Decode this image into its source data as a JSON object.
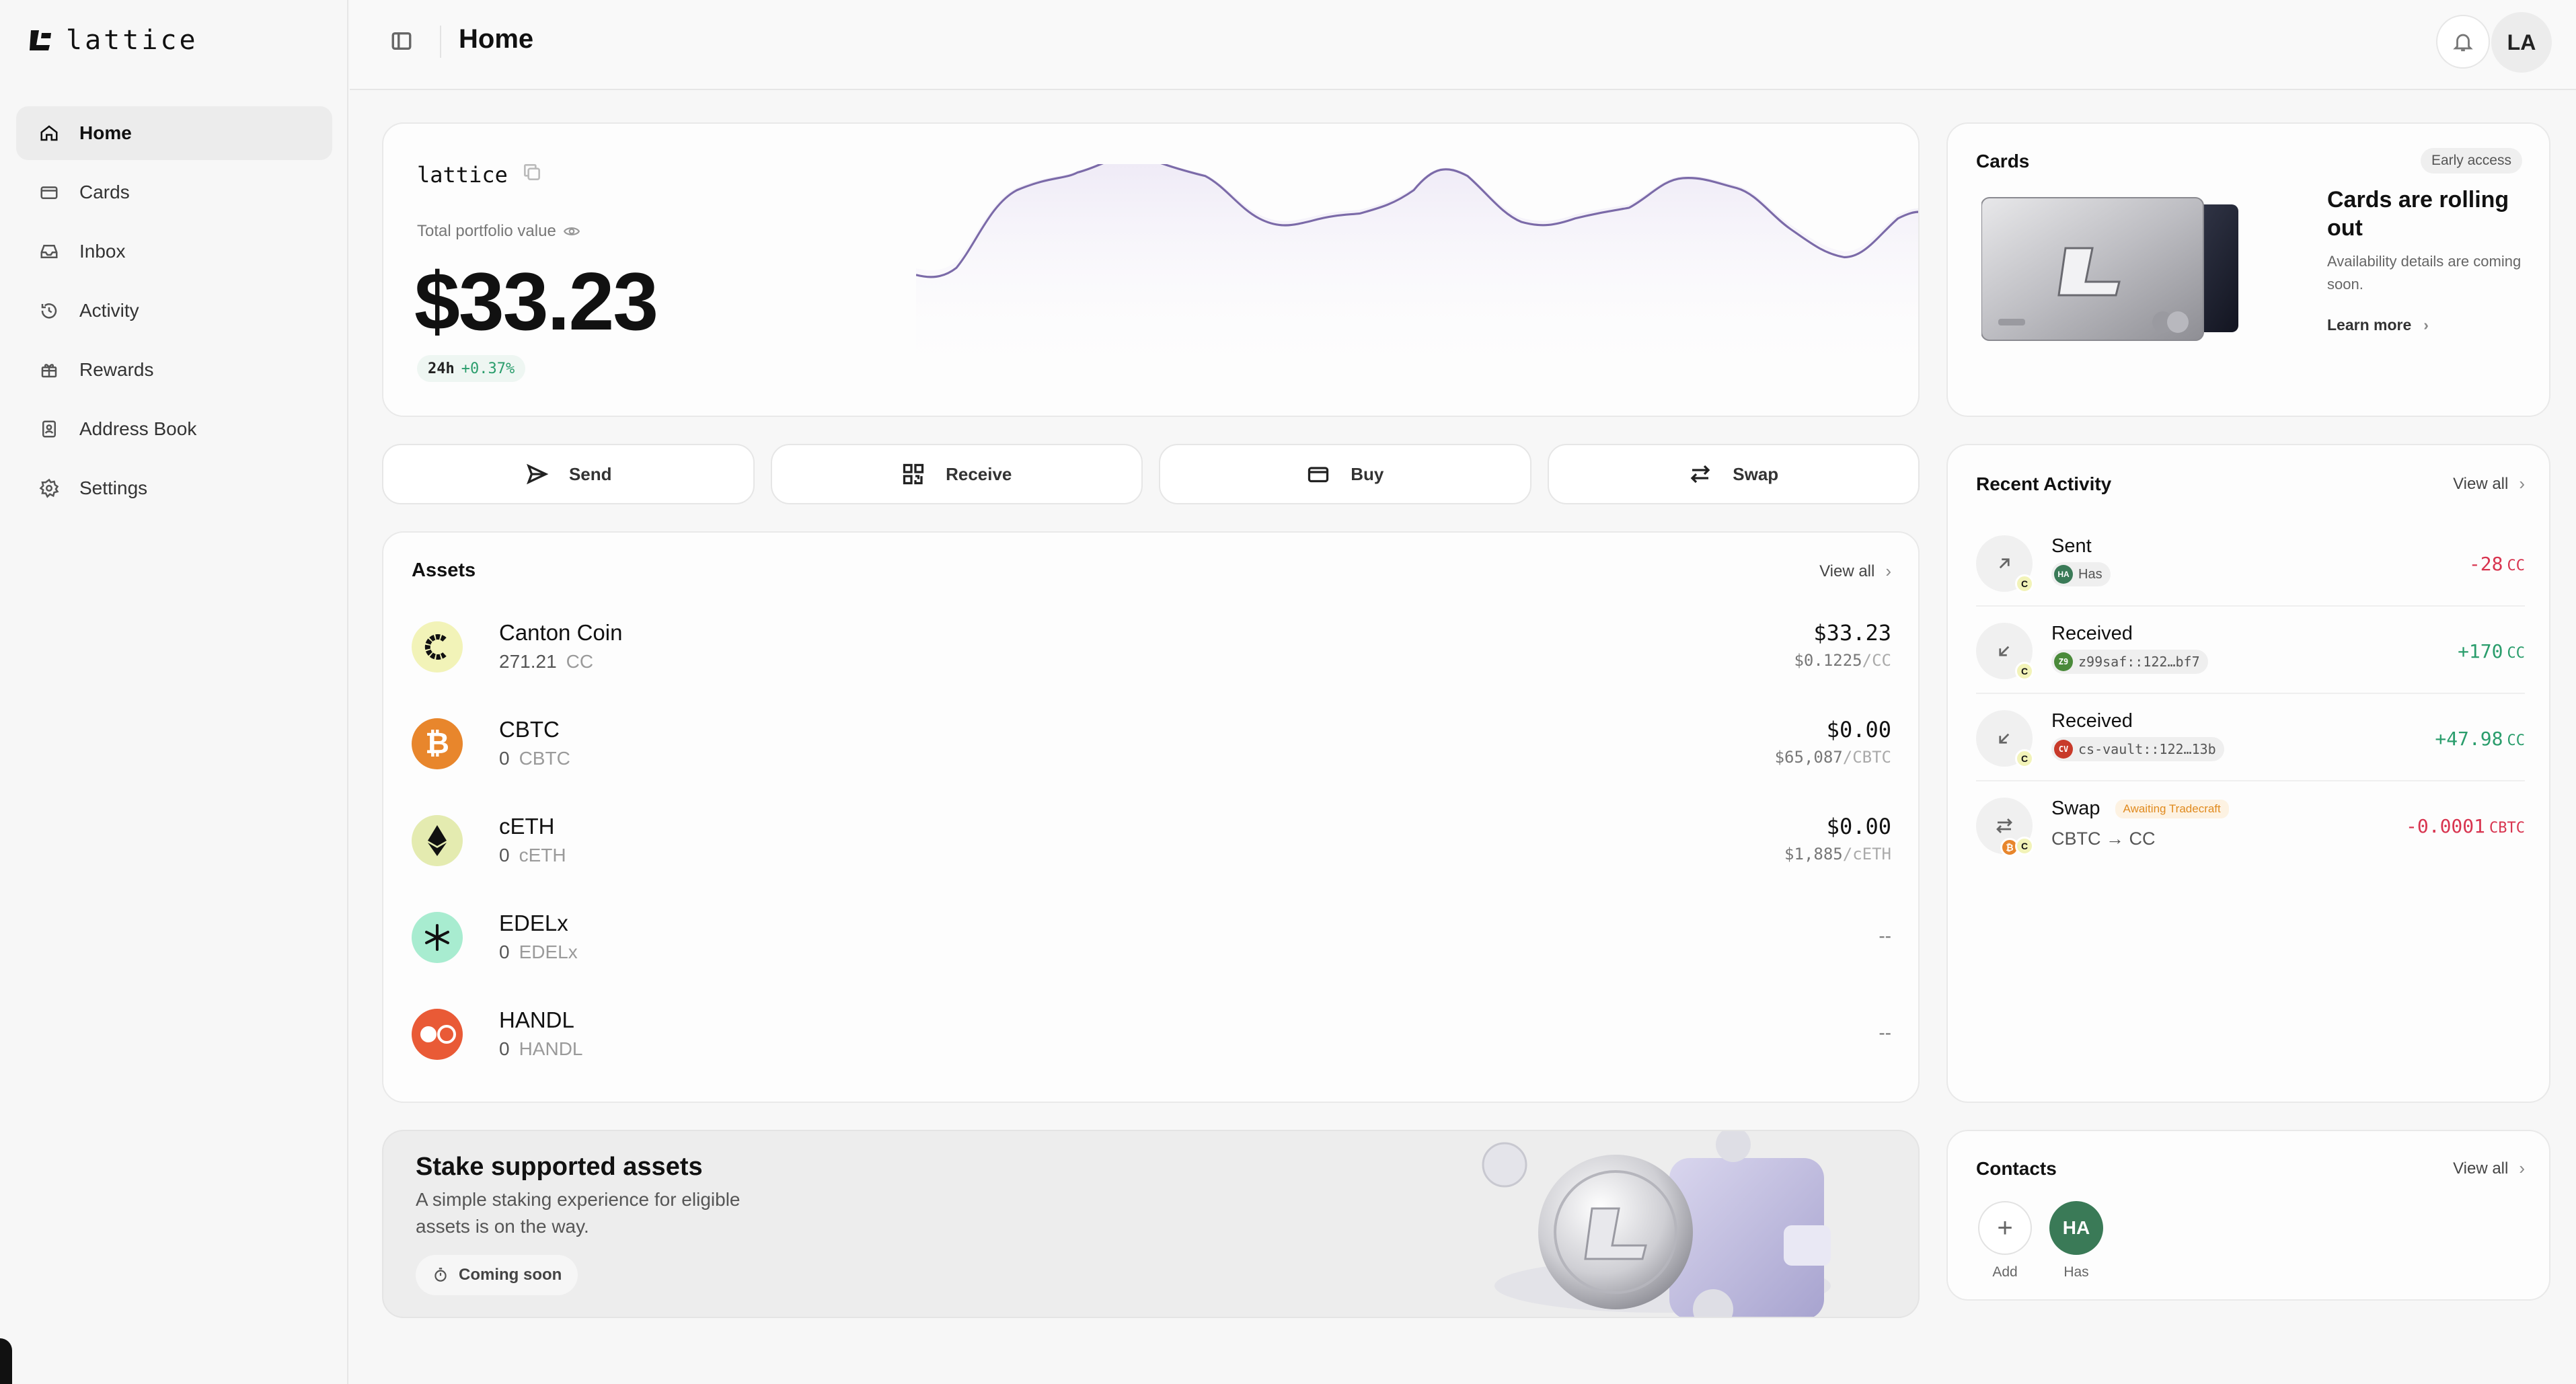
{
  "brand": {
    "name": "lattice"
  },
  "sidebar": {
    "items": [
      {
        "label": "Home",
        "icon": "home-icon"
      },
      {
        "label": "Cards",
        "icon": "card-icon"
      },
      {
        "label": "Inbox",
        "icon": "inbox-icon"
      },
      {
        "label": "Activity",
        "icon": "history-icon"
      },
      {
        "label": "Rewards",
        "icon": "gift-icon"
      },
      {
        "label": "Address Book",
        "icon": "contact-book-icon"
      },
      {
        "label": "Settings",
        "icon": "gear-icon"
      }
    ],
    "active": "Home"
  },
  "header": {
    "title": "Home",
    "avatar_initials": "LA"
  },
  "portfolio": {
    "wallet_name": "lattice",
    "label": "Total portfolio value",
    "value": "$33.23",
    "change_period": "24h",
    "change_value": "+0.37%"
  },
  "actions": [
    {
      "label": "Send",
      "icon": "send-icon"
    },
    {
      "label": "Receive",
      "icon": "qr-code-icon"
    },
    {
      "label": "Buy",
      "icon": "credit-card-icon"
    },
    {
      "label": "Swap",
      "icon": "swap-arrows-icon"
    }
  ],
  "assets": {
    "title": "Assets",
    "view_all": "View all",
    "rows": [
      {
        "name": "Canton Coin",
        "qty": "271.21",
        "symbol": "CC",
        "value": "$33.23",
        "price": "$0.1225",
        "unit": "/CC",
        "icon_color": "#f2f3b8"
      },
      {
        "name": "CBTC",
        "qty": "0",
        "symbol": "CBTC",
        "value": "$0.00",
        "price": "$65,087",
        "unit": "/CBTC",
        "icon_color": "#e8862c"
      },
      {
        "name": "cETH",
        "qty": "0",
        "symbol": "cETH",
        "value": "$0.00",
        "price": "$1,885",
        "unit": "/cETH",
        "icon_color": "#e4ebb0"
      },
      {
        "name": "EDELx",
        "qty": "0",
        "symbol": "EDELx",
        "value": "--",
        "price": "",
        "unit": "",
        "icon_color": "#a8ecd0"
      },
      {
        "name": "HANDL",
        "qty": "0",
        "symbol": "HANDL",
        "value": "--",
        "price": "",
        "unit": "",
        "icon_color": "#e95a36"
      }
    ]
  },
  "stake": {
    "title": "Stake supported assets",
    "subtitle": "A simple staking experience for eligible assets is on the way.",
    "badge": "Coming soon"
  },
  "cards_panel": {
    "title": "Cards",
    "badge": "Early access",
    "headline": "Cards are rolling out",
    "body": "Availability details are coming soon.",
    "link": "Learn more"
  },
  "activity": {
    "title": "Recent Activity",
    "view_all": "View all",
    "items": [
      {
        "type": "Sent",
        "counterparty": "Has",
        "chip": "HA",
        "chip_color": "#3a7a57",
        "amount": "-28",
        "unit": "CC",
        "direction": "out"
      },
      {
        "type": "Received",
        "counterparty": "z99saf::122…bf7",
        "chip": "Z9",
        "chip_color": "#4a8a3a",
        "amount": "+170",
        "unit": "CC",
        "direction": "in"
      },
      {
        "type": "Received",
        "counterparty": "cs-vault::122…13b",
        "chip": "CV",
        "chip_color": "#c83a2a",
        "amount": "+47.98",
        "unit": "CC",
        "direction": "in"
      },
      {
        "type": "Swap",
        "status": "Awaiting Tradecraft",
        "route": "CBTC → CC",
        "amount": "-0.0001",
        "unit": "CBTC",
        "direction": "out"
      }
    ]
  },
  "contacts": {
    "title": "Contacts",
    "view_all": "View all",
    "items": [
      {
        "initials": "+",
        "label": "Add"
      },
      {
        "initials": "HA",
        "label": "Has"
      }
    ]
  },
  "colors": {
    "positive": "#2a9d6c",
    "negative": "#d8344f",
    "chart_line": "#7b6aa8"
  }
}
